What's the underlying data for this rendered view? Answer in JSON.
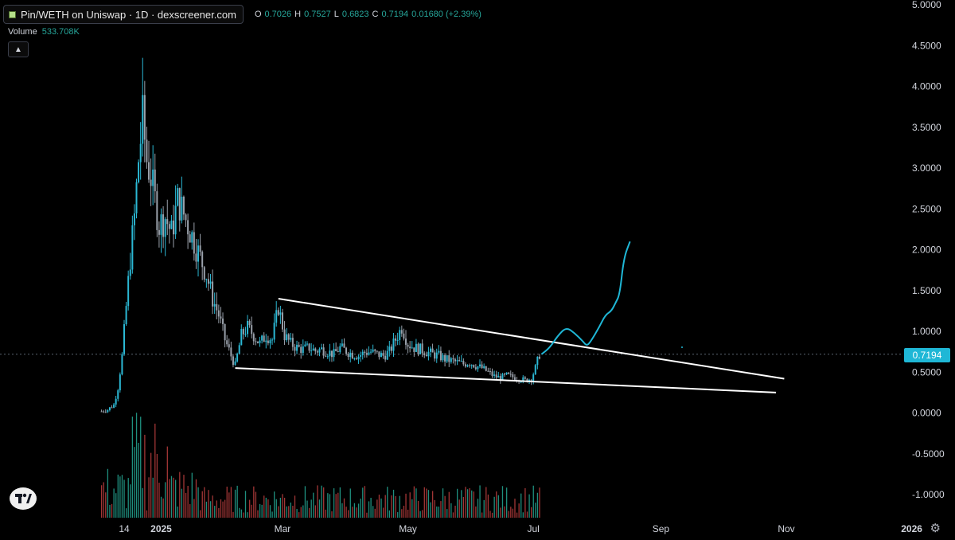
{
  "header": {
    "symbol_title": "Pin/WETH on Uniswap · 1D · dexscreener.com",
    "ohlc": {
      "o_label": "O",
      "o_value": "0.7026",
      "h_label": "H",
      "h_value": "0.7527",
      "l_label": "L",
      "l_value": "0.6823",
      "c_label": "C",
      "c_value": "0.7194",
      "change": "0.01680 (+2.39%)"
    },
    "volume_label": "Volume",
    "volume_value": "533.708K",
    "collapse_icon": "chevron-up-icon"
  },
  "last_price_label": "0.7194",
  "settings_icon": "gear-icon",
  "logo_icon": "tradingview-logo-icon",
  "colors": {
    "background": "#000000",
    "up": "#2bb8d4",
    "down": "#9aa1ab",
    "volume_up": "#1f8f7e",
    "volume_down": "#a23636",
    "trendline": "#ffffff",
    "drawing": "#1fb7d6",
    "axis_text": "#d1d4dc"
  },
  "chart_data": {
    "type": "candlestick",
    "title": "",
    "xlabel": "",
    "ylabel": "",
    "ylim": [
      -1.1,
      5.0
    ],
    "y_ticks": [
      "5.0000",
      "4.5000",
      "4.0000",
      "3.5000",
      "3.0000",
      "2.5000",
      "2.0000",
      "1.5000",
      "1.0000",
      "0.5000",
      "0.0000",
      "-0.5000",
      "-1.0000"
    ],
    "y_tick_values": [
      5.0,
      4.5,
      4.0,
      3.5,
      3.0,
      2.5,
      2.0,
      1.5,
      1.0,
      0.5,
      0.0,
      -0.5,
      -1.0
    ],
    "x_ticks": [
      "14",
      "2025",
      "Mar",
      "May",
      "Jul",
      "Sep",
      "Nov",
      "2026"
    ],
    "x_tick_dates": [
      "2024-12-14",
      "2025-01-01",
      "2025-03-01",
      "2025-05-01",
      "2025-07-01",
      "2025-09-01",
      "2025-11-01",
      "2026-01-01"
    ],
    "x_range": [
      "2024-11-29",
      "2026-01-05"
    ],
    "last_price": 0.7194,
    "close_path": [
      [
        "2024-12-03",
        0.02
      ],
      [
        "2024-12-06",
        0.04
      ],
      [
        "2024-12-09",
        0.1
      ],
      [
        "2024-12-11",
        0.3
      ],
      [
        "2024-12-13",
        0.7
      ],
      [
        "2024-12-15",
        1.3
      ],
      [
        "2024-12-17",
        1.9
      ],
      [
        "2024-12-19",
        2.4
      ],
      [
        "2024-12-21",
        3.1
      ],
      [
        "2024-12-23",
        3.6
      ],
      [
        "2024-12-25",
        3.1
      ],
      [
        "2024-12-27",
        2.9
      ],
      [
        "2024-12-29",
        2.6
      ],
      [
        "2024-12-31",
        2.3
      ],
      [
        "2025-01-03",
        2.4
      ],
      [
        "2025-01-06",
        2.2
      ],
      [
        "2025-01-09",
        2.6
      ],
      [
        "2025-01-11",
        2.5
      ],
      [
        "2025-01-14",
        2.3
      ],
      [
        "2025-01-17",
        2.1
      ],
      [
        "2025-01-20",
        1.9
      ],
      [
        "2025-01-23",
        1.7
      ],
      [
        "2025-01-26",
        1.4
      ],
      [
        "2025-01-29",
        1.2
      ],
      [
        "2025-02-01",
        0.9
      ],
      [
        "2025-02-04",
        0.7
      ],
      [
        "2025-02-06",
        0.58
      ],
      [
        "2025-02-09",
        0.95
      ],
      [
        "2025-02-12",
        1.05
      ],
      [
        "2025-02-15",
        0.95
      ],
      [
        "2025-02-18",
        0.85
      ],
      [
        "2025-02-21",
        0.95
      ],
      [
        "2025-02-24",
        0.9
      ],
      [
        "2025-02-27",
        1.3
      ],
      [
        "2025-03-02",
        0.95
      ],
      [
        "2025-03-05",
        0.85
      ],
      [
        "2025-03-08",
        0.8
      ],
      [
        "2025-03-11",
        0.78
      ],
      [
        "2025-03-14",
        0.8
      ],
      [
        "2025-03-17",
        0.76
      ],
      [
        "2025-03-20",
        0.78
      ],
      [
        "2025-03-23",
        0.75
      ],
      [
        "2025-03-26",
        0.72
      ],
      [
        "2025-03-29",
        0.8
      ],
      [
        "2025-04-01",
        0.76
      ],
      [
        "2025-04-04",
        0.72
      ],
      [
        "2025-04-07",
        0.7
      ],
      [
        "2025-04-10",
        0.74
      ],
      [
        "2025-04-13",
        0.75
      ],
      [
        "2025-04-16",
        0.72
      ],
      [
        "2025-04-19",
        0.7
      ],
      [
        "2025-04-22",
        0.75
      ],
      [
        "2025-04-25",
        0.9
      ],
      [
        "2025-04-28",
        1.05
      ],
      [
        "2025-05-01",
        0.85
      ],
      [
        "2025-05-04",
        0.8
      ],
      [
        "2025-05-07",
        0.78
      ],
      [
        "2025-05-10",
        0.75
      ],
      [
        "2025-05-13",
        0.72
      ],
      [
        "2025-05-16",
        0.7
      ],
      [
        "2025-05-19",
        0.66
      ],
      [
        "2025-05-22",
        0.64
      ],
      [
        "2025-05-25",
        0.62
      ],
      [
        "2025-05-28",
        0.6
      ],
      [
        "2025-05-31",
        0.62
      ],
      [
        "2025-06-03",
        0.58
      ],
      [
        "2025-06-06",
        0.55
      ],
      [
        "2025-06-09",
        0.5
      ],
      [
        "2025-06-12",
        0.45
      ],
      [
        "2025-06-15",
        0.43
      ],
      [
        "2025-06-18",
        0.46
      ],
      [
        "2025-06-21",
        0.44
      ],
      [
        "2025-06-24",
        0.42
      ],
      [
        "2025-06-27",
        0.4
      ],
      [
        "2025-06-30",
        0.42
      ],
      [
        "2025-07-02",
        0.55
      ],
      [
        "2025-07-04",
        0.72
      ]
    ],
    "trendlines": [
      {
        "name": "upper",
        "from": [
          "2025-02-27",
          1.4
        ],
        "to": [
          "2025-10-31",
          0.42
        ]
      },
      {
        "name": "lower",
        "from": [
          "2025-02-06",
          0.55
        ],
        "to": [
          "2025-10-27",
          0.25
        ]
      }
    ],
    "drawing_path": [
      [
        "2025-07-05",
        0.72
      ],
      [
        "2025-07-09",
        0.8
      ],
      [
        "2025-07-13",
        0.95
      ],
      [
        "2025-07-17",
        1.05
      ],
      [
        "2025-07-21",
        0.98
      ],
      [
        "2025-07-25",
        0.88
      ],
      [
        "2025-07-27",
        0.82
      ],
      [
        "2025-07-29",
        0.88
      ],
      [
        "2025-08-02",
        1.05
      ],
      [
        "2025-08-05",
        1.2
      ],
      [
        "2025-08-08",
        1.25
      ],
      [
        "2025-08-10",
        1.35
      ],
      [
        "2025-08-12",
        1.45
      ],
      [
        "2025-08-14",
        1.9
      ],
      [
        "2025-08-17",
        2.1
      ]
    ]
  }
}
